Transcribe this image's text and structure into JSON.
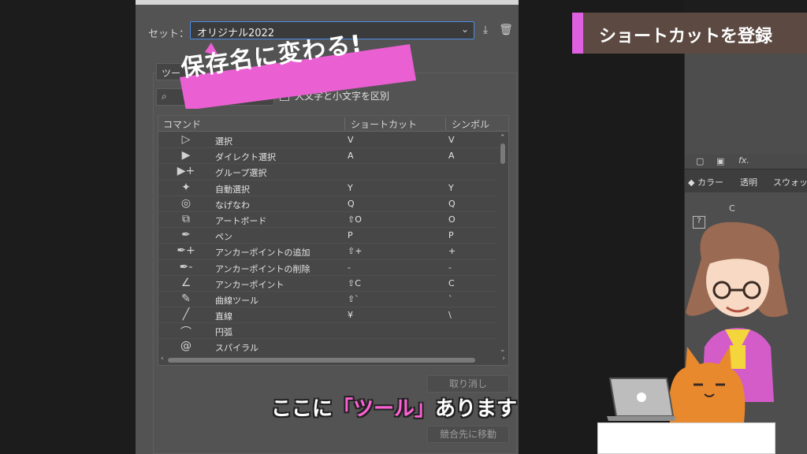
{
  "dialog": {
    "set_label": "セット：",
    "set_value": "オリジナル2022",
    "tool_dropdown": "ツー",
    "case_sensitive_label": "大文字と小文字を区別",
    "columns": [
      "コマンド",
      "ショートカット",
      "シンボル"
    ],
    "rows": [
      {
        "icon": "selection-tool-icon",
        "glyph": "▷",
        "name": "選択",
        "shortcut": "V",
        "symbol": "V"
      },
      {
        "icon": "direct-selection-tool-icon",
        "glyph": "▶",
        "name": "ダイレクト選択",
        "shortcut": "A",
        "symbol": "A"
      },
      {
        "icon": "group-selection-tool-icon",
        "glyph": "▶+",
        "name": "グループ選択",
        "shortcut": "",
        "symbol": ""
      },
      {
        "icon": "magic-wand-tool-icon",
        "glyph": "✦",
        "name": "自動選択",
        "shortcut": "Y",
        "symbol": "Y"
      },
      {
        "icon": "lasso-tool-icon",
        "glyph": "◎",
        "name": "なげなわ",
        "shortcut": "Q",
        "symbol": "Q"
      },
      {
        "icon": "artboard-tool-icon",
        "glyph": "⧉",
        "name": "アートボード",
        "shortcut": "⇧O",
        "symbol": "O"
      },
      {
        "icon": "pen-tool-icon",
        "glyph": "✒",
        "name": "ペン",
        "shortcut": "P",
        "symbol": "P"
      },
      {
        "icon": "add-anchor-point-tool-icon",
        "glyph": "✒+",
        "name": "アンカーポイントの追加",
        "shortcut": "⇧+",
        "symbol": "+"
      },
      {
        "icon": "delete-anchor-point-tool-icon",
        "glyph": "✒-",
        "name": "アンカーポイントの削除",
        "shortcut": "-",
        "symbol": "-"
      },
      {
        "icon": "anchor-point-tool-icon",
        "glyph": "∠",
        "name": "アンカーポイント",
        "shortcut": "⇧C",
        "symbol": "C"
      },
      {
        "icon": "curvature-tool-icon",
        "glyph": "✎",
        "name": "曲線ツール",
        "shortcut": "⇧`",
        "symbol": "`"
      },
      {
        "icon": "line-segment-tool-icon",
        "glyph": "╱",
        "name": "直線",
        "shortcut": "¥",
        "symbol": "\\"
      },
      {
        "icon": "arc-tool-icon",
        "glyph": "⌒",
        "name": "円弧",
        "shortcut": "",
        "symbol": ""
      },
      {
        "icon": "spiral-tool-icon",
        "glyph": "@",
        "name": "スパイラル",
        "shortcut": "",
        "symbol": ""
      }
    ],
    "undo_button": "取り消し",
    "goto_conflict_button": "競合先に移動"
  },
  "overlay": {
    "callout_text": "保存名に変わる!",
    "caption_pre": "ここに",
    "caption_highlight": "「ツール」",
    "caption_post": "あります"
  },
  "banner": {
    "title": "ショートカットを登録",
    "accent_color": "#de5fe0"
  },
  "right_panel": {
    "tabs": [
      "カラー",
      "透明",
      "スウォッ"
    ],
    "channel_label": "C",
    "fx_label": "fx."
  },
  "colors": {
    "callout": "#ea5fd2",
    "caption_highlight": "#ff60d6",
    "selection_border": "#4d8be5"
  }
}
